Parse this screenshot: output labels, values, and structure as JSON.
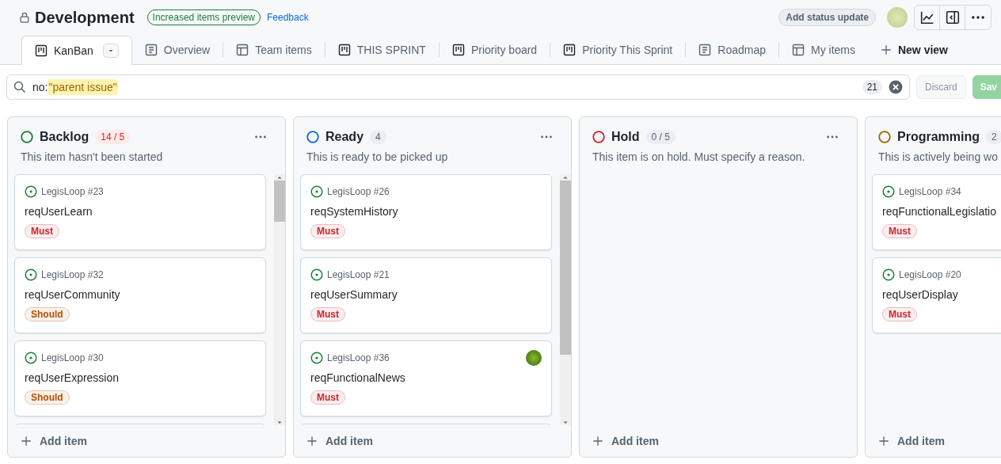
{
  "project": {
    "title": "Development",
    "private": true,
    "preview_badge": "Increased items preview",
    "feedback_link": "Feedback",
    "status_button": "Add status update"
  },
  "tabs": [
    {
      "label": "KanBan",
      "kind": "board",
      "selected": true
    },
    {
      "label": "Overview",
      "kind": "list",
      "selected": false
    },
    {
      "label": "Team items",
      "kind": "table",
      "selected": false
    },
    {
      "label": "THIS SPRINT",
      "kind": "board",
      "selected": false
    },
    {
      "label": "Priority board",
      "kind": "board",
      "selected": false
    },
    {
      "label": "Priority This Sprint",
      "kind": "board",
      "selected": false
    },
    {
      "label": "Roadmap",
      "kind": "list",
      "selected": false
    },
    {
      "label": "My items",
      "kind": "table",
      "selected": false
    }
  ],
  "new_view": "New view",
  "filter": {
    "prefix": "no:",
    "value": "\"parent issue\"",
    "count": "21",
    "discard": "Discard",
    "save": "Sav"
  },
  "columns": [
    {
      "name": "Backlog",
      "color": "#1a7f37",
      "count": "14 / 5",
      "over_limit": true,
      "description": "This item hasn't been started",
      "scrollbar": true,
      "add_item": "Add item",
      "cards": [
        {
          "repo": "LegisLoop #23",
          "title": "reqUserLearn",
          "label": {
            "text": "Must",
            "color": "#d1242f"
          }
        },
        {
          "repo": "LegisLoop #32",
          "title": "reqUserCommunity",
          "label": {
            "text": "Should",
            "color": "#bc4c00"
          }
        },
        {
          "repo": "LegisLoop #30",
          "title": "reqUserExpression",
          "label": {
            "text": "Should",
            "color": "#bc4c00"
          }
        }
      ]
    },
    {
      "name": "Ready",
      "color": "#0969da",
      "count": "4",
      "over_limit": false,
      "description": "This is ready to be picked up",
      "scrollbar": true,
      "add_item": "Add item",
      "cards": [
        {
          "repo": "LegisLoop #26",
          "title": "reqSystemHistory",
          "label": {
            "text": "Must",
            "color": "#d1242f"
          }
        },
        {
          "repo": "LegisLoop #21",
          "title": "reqUserSummary",
          "label": {
            "text": "Must",
            "color": "#d1242f"
          }
        },
        {
          "repo": "LegisLoop #36",
          "title": "reqFunctionalNews",
          "label": {
            "text": "Must",
            "color": "#d1242f"
          },
          "assignee_avatar": true
        }
      ]
    },
    {
      "name": "Hold",
      "color": "#cf222e",
      "count": "0 / 5",
      "over_limit": false,
      "description": "This item is on hold. Must specify a reason.",
      "add_item": "Add item"
    },
    {
      "name": "Programming",
      "color": "#9a6700",
      "count": "2",
      "over_limit": false,
      "description": "This is actively being wo",
      "add_item": "Add item",
      "cards": [
        {
          "repo": "LegisLoop #34",
          "title": "reqFunctionalLegislatio",
          "label": {
            "text": "Must",
            "color": "#d1242f"
          }
        },
        {
          "repo": "LegisLoop #20",
          "title": "reqUserDisplay",
          "label": {
            "text": "Must",
            "color": "#d1242f"
          }
        }
      ]
    }
  ]
}
